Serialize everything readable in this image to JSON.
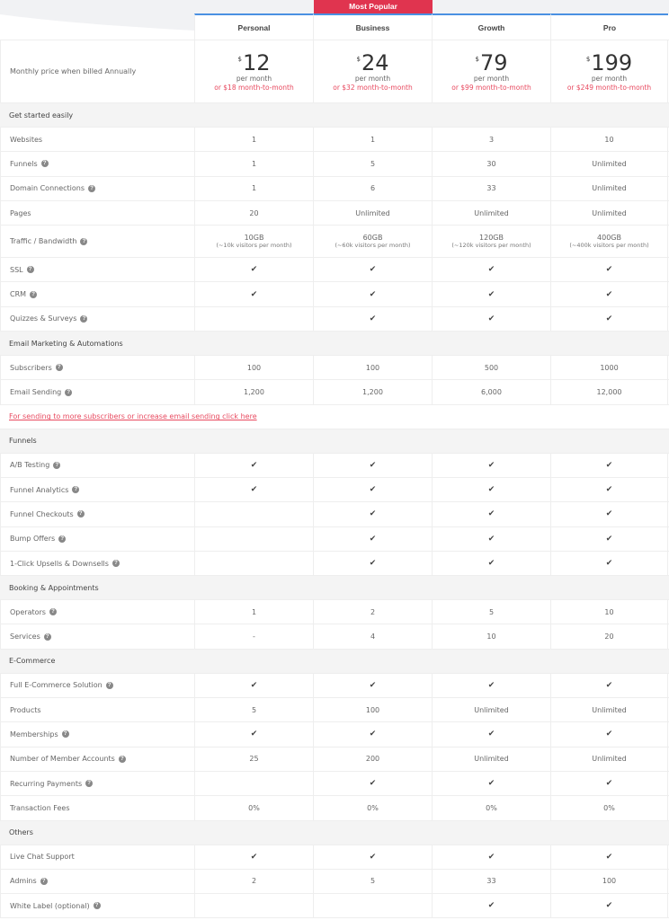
{
  "badge": {
    "label": "Most Popular",
    "color": "#e0344f"
  },
  "accent": "#4a90e2",
  "plans": [
    {
      "name": "Personal",
      "currency": "$",
      "price": "12",
      "per": "per month",
      "alt": "or $18 month-to-month"
    },
    {
      "name": "Business",
      "currency": "$",
      "price": "24",
      "per": "per month",
      "alt": "or $32 month-to-month"
    },
    {
      "name": "Growth",
      "currency": "$",
      "price": "79",
      "per": "per month",
      "alt": "or $99 month-to-month"
    },
    {
      "name": "Pro",
      "currency": "$",
      "price": "199",
      "per": "per month",
      "alt": "or $249 month-to-month"
    }
  ],
  "price_label": "Monthly price when billed Annually",
  "email_link": "For sending to more subscribers or increase email sending click here",
  "sections": [
    {
      "title": "Get started easily",
      "rows": [
        {
          "label": "Websites",
          "help": false,
          "values": [
            "1",
            "1",
            "3",
            "10"
          ]
        },
        {
          "label": "Funnels",
          "help": true,
          "values": [
            "1",
            "5",
            "30",
            "Unlimited"
          ]
        },
        {
          "label": "Domain Connections",
          "help": true,
          "values": [
            "1",
            "6",
            "33",
            "Unlimited"
          ]
        },
        {
          "label": "Pages",
          "help": false,
          "values": [
            "20",
            "Unlimited",
            "Unlimited",
            "Unlimited"
          ]
        },
        {
          "label": "Traffic / Bandwidth",
          "help": true,
          "tall": true,
          "values": [
            "10GB",
            "60GB",
            "120GB",
            "400GB"
          ],
          "notes": [
            "(~10k visitors per month)",
            "(~60k visitors per month)",
            "(~120k visitors per month)",
            "(~400k visitors per month)"
          ]
        },
        {
          "label": "SSL",
          "help": true,
          "values": [
            "check",
            "check",
            "check",
            "check"
          ]
        },
        {
          "label": "CRM",
          "help": true,
          "values": [
            "check",
            "check",
            "check",
            "check"
          ]
        },
        {
          "label": "Quizzes & Surveys",
          "help": true,
          "values": [
            "",
            "check",
            "check",
            "check"
          ]
        }
      ]
    },
    {
      "title": "Email Marketing & Automations",
      "rows": [
        {
          "label": "Subscribers",
          "help": true,
          "values": [
            "100",
            "100",
            "500",
            "1000"
          ]
        },
        {
          "label": "Email Sending",
          "help": true,
          "values": [
            "1,200",
            "1,200",
            "6,000",
            "12,000"
          ]
        }
      ],
      "link": true
    },
    {
      "title": "Funnels",
      "rows": [
        {
          "label": "A/B Testing",
          "help": true,
          "values": [
            "check",
            "check",
            "check",
            "check"
          ]
        },
        {
          "label": "Funnel Analytics",
          "help": true,
          "values": [
            "check",
            "check",
            "check",
            "check"
          ]
        },
        {
          "label": "Funnel Checkouts",
          "help": true,
          "values": [
            "",
            "check",
            "check",
            "check"
          ]
        },
        {
          "label": "Bump Offers",
          "help": true,
          "values": [
            "",
            "check",
            "check",
            "check"
          ]
        },
        {
          "label": "1-Click Upsells & Downsells",
          "help": true,
          "values": [
            "",
            "check",
            "check",
            "check"
          ]
        }
      ]
    },
    {
      "title": "Booking & Appointments",
      "rows": [
        {
          "label": "Operators",
          "help": true,
          "values": [
            "1",
            "2",
            "5",
            "10"
          ]
        },
        {
          "label": "Services",
          "help": true,
          "values": [
            "-",
            "4",
            "10",
            "20"
          ]
        }
      ]
    },
    {
      "title": "E-Commerce",
      "rows": [
        {
          "label": "Full E-Commerce Solution",
          "help": true,
          "values": [
            "check",
            "check",
            "check",
            "check"
          ]
        },
        {
          "label": "Products",
          "help": false,
          "values": [
            "5",
            "100",
            "Unlimited",
            "Unlimited"
          ]
        },
        {
          "label": "Memberships",
          "help": true,
          "values": [
            "check",
            "check",
            "check",
            "check"
          ]
        },
        {
          "label": "Number of Member Accounts",
          "help": true,
          "values": [
            "25",
            "200",
            "Unlimited",
            "Unlimited"
          ]
        },
        {
          "label": "Recurring Payments",
          "help": true,
          "values": [
            "",
            "check",
            "check",
            "check"
          ]
        },
        {
          "label": "Transaction Fees",
          "help": false,
          "values": [
            "0%",
            "0%",
            "0%",
            "0%"
          ]
        }
      ]
    },
    {
      "title": "Others",
      "rows": [
        {
          "label": "Live Chat Support",
          "help": false,
          "values": [
            "check",
            "check",
            "check",
            "check"
          ]
        },
        {
          "label": "Admins",
          "help": true,
          "values": [
            "2",
            "5",
            "33",
            "100"
          ]
        },
        {
          "label": "White Label (optional)",
          "help": true,
          "values": [
            "",
            "",
            "check",
            "check"
          ]
        }
      ]
    }
  ]
}
